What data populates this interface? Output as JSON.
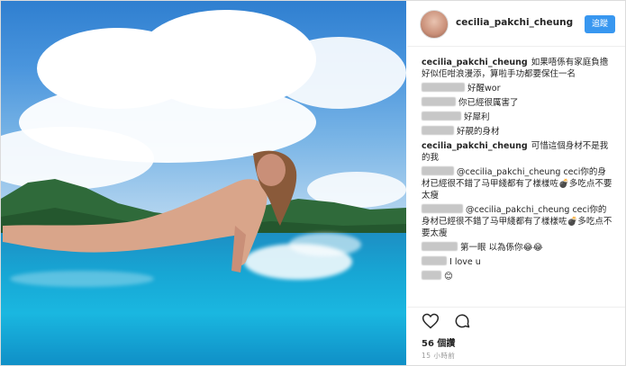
{
  "post": {
    "username": "cecilia_pakchi_cheung",
    "follow_label": "追蹤",
    "comments": [
      {
        "author": "cecilia_pakchi_cheung",
        "text": "如果唔係有家庭負擔好似佢咁浪漫添，算啦手功都要保住一名",
        "blurred": false
      },
      {
        "author": "",
        "text": "好醒wor",
        "blurred": true
      },
      {
        "author": "",
        "text": "你已經很厲害了",
        "blurred": true
      },
      {
        "author": "",
        "text": "好犀利",
        "blurred": true
      },
      {
        "author": "",
        "text": "好靚的身材",
        "blurred": true
      },
      {
        "author": "cecilia_pakchi_cheung",
        "text": "可惜這個身材不是我的我",
        "blurred": false
      },
      {
        "author": "",
        "text": "@cecilia_pakchi_cheung ceci你的身材已經很不錯了马甲綫都有了樣樣咗💣多吃点不要太瘦",
        "blurred": true
      },
      {
        "author": "",
        "text": "@cecilia_pakchi_cheung ceci你的身材已經很不錯了马甲綫都有了樣樣咗💣多吃点不要太瘦",
        "blurred": true
      },
      {
        "author": "",
        "text": "第一眼 以為係你😂😂",
        "blurred": true
      },
      {
        "author": "",
        "text": "I love u",
        "blurred": true
      },
      {
        "author": "",
        "text": "😊",
        "blurred": true
      }
    ],
    "likes": "56 個讚",
    "time": "15 小時前"
  },
  "icons": [
    "heart-icon",
    "comment-icon"
  ],
  "colors": {
    "follow_button": "#3897f0",
    "sea": "#17a6d4",
    "sky": "#4a95dd"
  }
}
